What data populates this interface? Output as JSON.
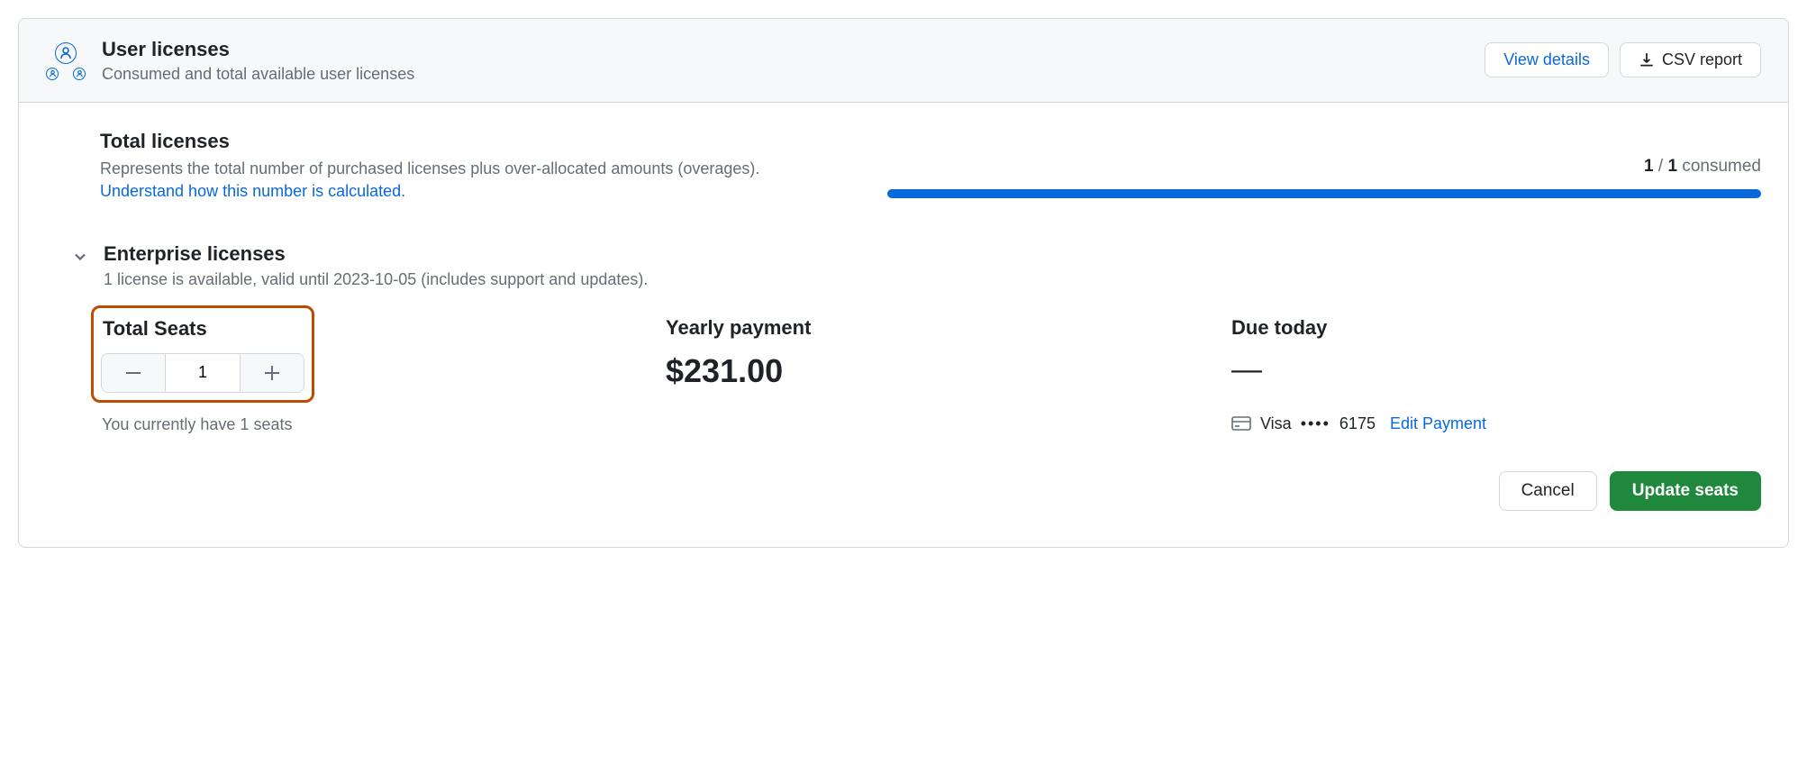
{
  "header": {
    "title": "User licenses",
    "subtitle": "Consumed and total available user licenses",
    "view_details": "View details",
    "csv_report": "CSV report"
  },
  "total_licenses": {
    "title": "Total licenses",
    "description": "Represents the total number of purchased licenses plus over-allocated amounts (overages).",
    "link": "Understand how this number is calculated.",
    "consumed_used": "1",
    "consumed_total": "1",
    "consumed_suffix": "consumed"
  },
  "enterprise": {
    "title": "Enterprise licenses",
    "description": "1 license is available, valid until 2023-10-05 (includes support and updates)."
  },
  "seats": {
    "title": "Total Seats",
    "value": "1",
    "note": "You currently have 1 seats"
  },
  "yearly": {
    "title": "Yearly payment",
    "amount": "$231.00"
  },
  "due": {
    "title": "Due today",
    "amount": "—"
  },
  "payment": {
    "brand": "Visa",
    "dots": "••••",
    "last4": "6175",
    "edit": "Edit Payment"
  },
  "actions": {
    "cancel": "Cancel",
    "update": "Update seats"
  }
}
